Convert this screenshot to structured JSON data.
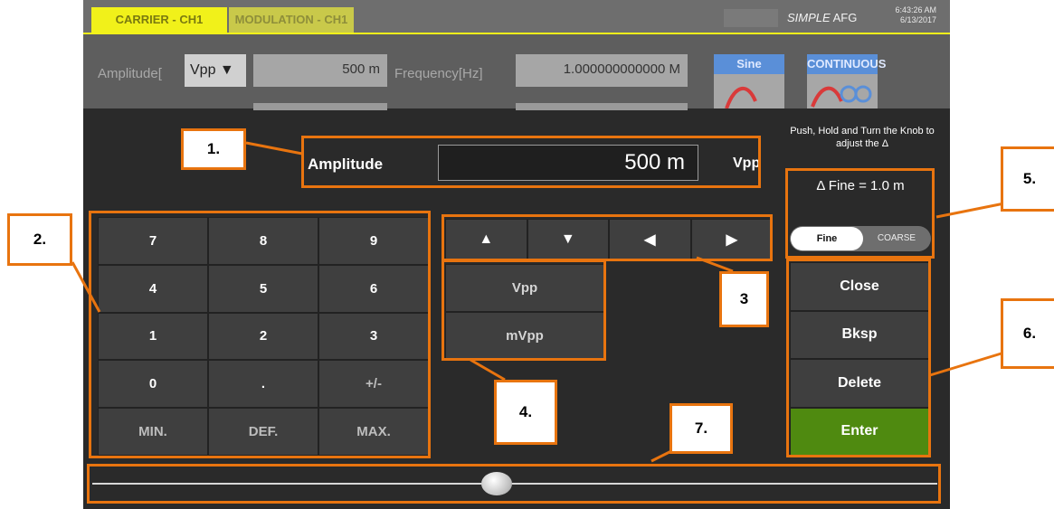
{
  "header": {
    "tabs": [
      {
        "label": "CARRIER - CH1"
      },
      {
        "label": "MODULATION - CH1"
      }
    ],
    "brand_prefix": "SIMPLE",
    "brand_suffix": "AFG",
    "time": "6:43:26 AM",
    "date": "6/13/2017"
  },
  "params": {
    "amplitude_label": "Amplitude[",
    "unit_selector": "Vpp ▼",
    "amplitude_value": "500 m",
    "frequency_label": "Frequency[Hz]",
    "frequency_value": "1.000000000000 M",
    "waveform": "Sine",
    "mode": "CONTINUOUS"
  },
  "dialog": {
    "title": "Amplitude",
    "value": "500 m",
    "unit": "Vpp",
    "hint": "Push, Hold and Turn the Knob to adjust the Δ",
    "delta": "Δ Fine = 1.0 m",
    "toggle_fine": "Fine",
    "toggle_coarse": "COARSE"
  },
  "keypad": [
    "7",
    "8",
    "9",
    "4",
    "5",
    "6",
    "1",
    "2",
    "3",
    "0",
    ".",
    "+/-",
    "MIN.",
    "DEF.",
    "MAX."
  ],
  "arrows": [
    "▲",
    "▼",
    "◀",
    "▶"
  ],
  "unit_buttons": [
    "Vpp",
    "mVpp"
  ],
  "side_buttons": [
    "Close",
    "Bksp",
    "Delete",
    "Enter"
  ],
  "slider": {
    "position": 0.5
  },
  "callouts": [
    "1.",
    "2.",
    "3",
    "4.",
    "5.",
    "6.",
    "7."
  ],
  "colors": {
    "annotation": "#e8740f",
    "tab_active": "#f1f11a",
    "enter": "#4f8a10",
    "waveform_caption": "#5a8fd8"
  }
}
